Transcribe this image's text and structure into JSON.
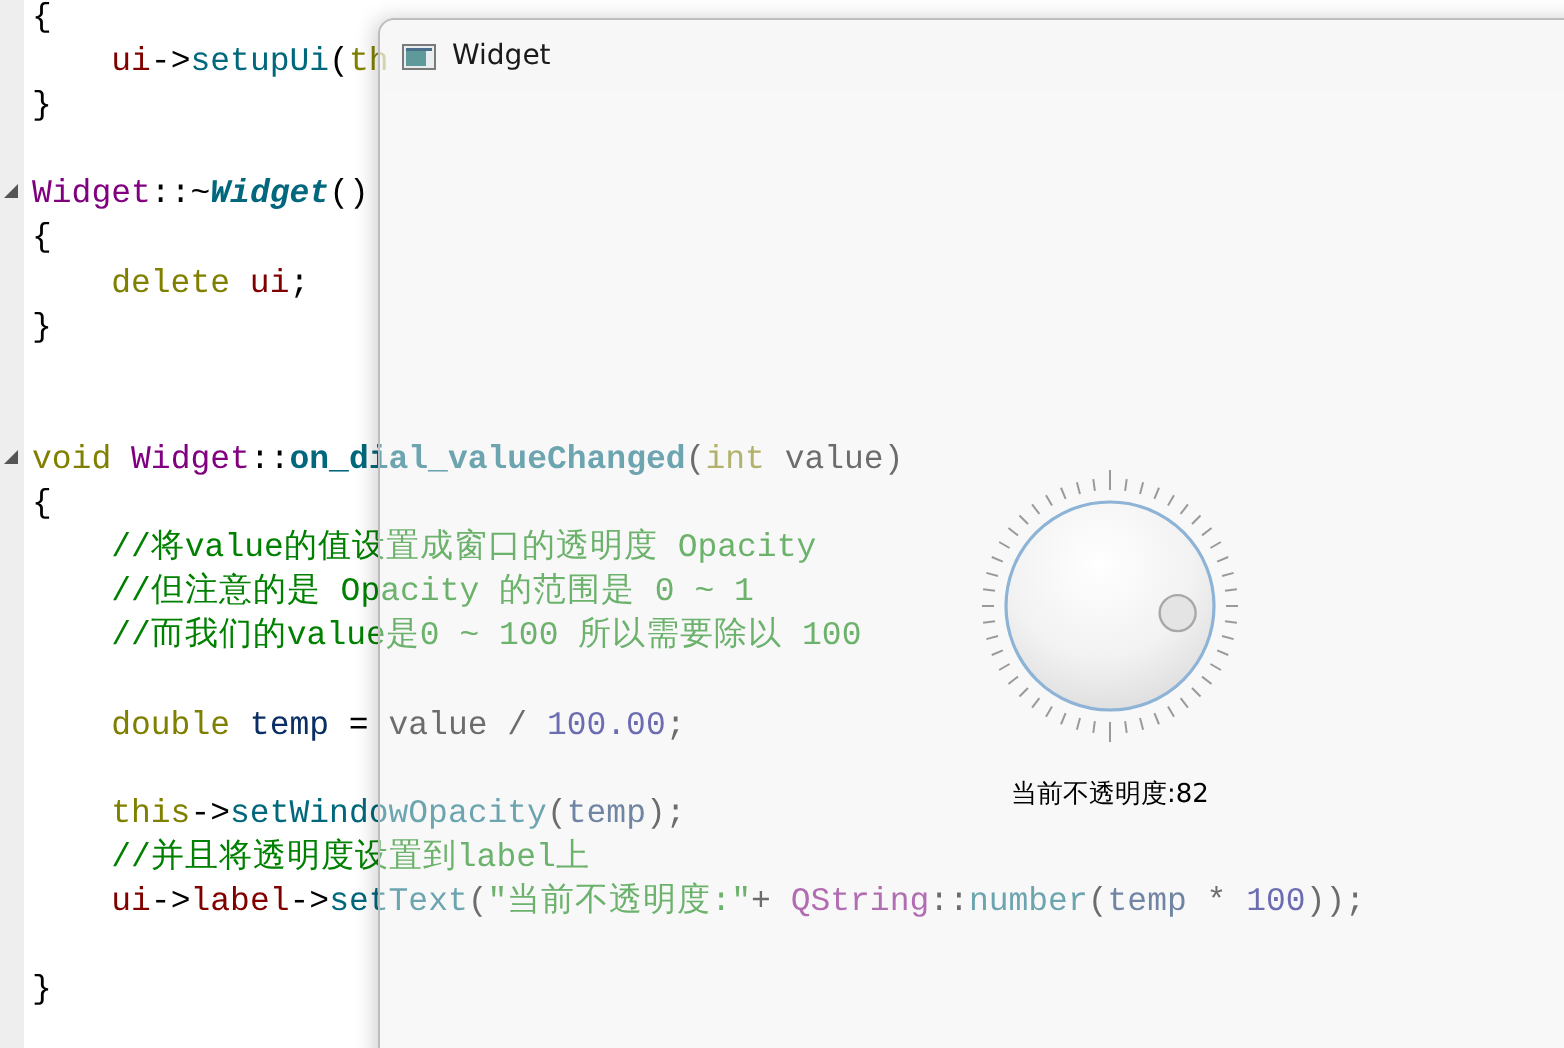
{
  "editor": {
    "lines": [
      {
        "kind": "code",
        "fold": false,
        "tokens": [
          {
            "kind": "plain",
            "text": "{"
          }
        ]
      },
      {
        "kind": "code",
        "fold": false,
        "tokens": [
          {
            "kind": "member",
            "text": "    ui"
          },
          {
            "kind": "plain",
            "text": "->"
          },
          {
            "kind": "func",
            "text": "setupUi"
          },
          {
            "kind": "plain",
            "text": "("
          },
          {
            "kind": "keyword",
            "text": "th"
          }
        ]
      },
      {
        "kind": "code",
        "fold": false,
        "tokens": [
          {
            "kind": "plain",
            "text": "}"
          }
        ]
      },
      {
        "kind": "blank"
      },
      {
        "kind": "code",
        "fold": true,
        "tokens": [
          {
            "kind": "type",
            "text": "Widget"
          },
          {
            "kind": "plain",
            "text": "::~"
          },
          {
            "kind": "func-italic",
            "text": "Widget"
          },
          {
            "kind": "plain",
            "text": "()"
          }
        ]
      },
      {
        "kind": "code",
        "fold": false,
        "tokens": [
          {
            "kind": "plain",
            "text": "{"
          }
        ]
      },
      {
        "kind": "code",
        "fold": false,
        "tokens": [
          {
            "kind": "keyword",
            "text": "    delete "
          },
          {
            "kind": "member",
            "text": "ui"
          },
          {
            "kind": "plain",
            "text": ";"
          }
        ]
      },
      {
        "kind": "code",
        "fold": false,
        "tokens": [
          {
            "kind": "plain",
            "text": "}"
          }
        ]
      },
      {
        "kind": "blank"
      },
      {
        "kind": "blank"
      },
      {
        "kind": "code",
        "fold": true,
        "tokens": [
          {
            "kind": "keyword",
            "text": "void "
          },
          {
            "kind": "type",
            "text": "Widget"
          },
          {
            "kind": "plain",
            "text": "::"
          },
          {
            "kind": "func-bold",
            "text": "on_dial_valueChanged"
          },
          {
            "kind": "plain",
            "text": "("
          },
          {
            "kind": "keyword",
            "text": "int"
          },
          {
            "kind": "plain",
            "text": " value)"
          }
        ]
      },
      {
        "kind": "code",
        "fold": false,
        "tokens": [
          {
            "kind": "plain",
            "text": "{"
          }
        ]
      },
      {
        "kind": "code",
        "fold": false,
        "tokens": [
          {
            "kind": "comment",
            "text": "    //将value的值设置成窗口的透明度 Opacity"
          }
        ]
      },
      {
        "kind": "code",
        "fold": false,
        "tokens": [
          {
            "kind": "comment",
            "text": "    //但注意的是 Opacity 的范围是 0 ~ 1"
          }
        ]
      },
      {
        "kind": "code",
        "fold": false,
        "tokens": [
          {
            "kind": "comment",
            "text": "    //而我们的value是0 ~ 100 所以需要除以 100"
          }
        ]
      },
      {
        "kind": "blank"
      },
      {
        "kind": "code",
        "fold": false,
        "tokens": [
          {
            "kind": "keyword",
            "text": "    double "
          },
          {
            "kind": "local",
            "text": "temp"
          },
          {
            "kind": "plain",
            "text": " = value / "
          },
          {
            "kind": "number",
            "text": "100.00"
          },
          {
            "kind": "plain",
            "text": ";"
          }
        ]
      },
      {
        "kind": "blank"
      },
      {
        "kind": "code",
        "fold": false,
        "tokens": [
          {
            "kind": "keyword",
            "text": "    this"
          },
          {
            "kind": "plain",
            "text": "->"
          },
          {
            "kind": "func",
            "text": "setWindowOpacity"
          },
          {
            "kind": "plain",
            "text": "("
          },
          {
            "kind": "local",
            "text": "temp"
          },
          {
            "kind": "plain",
            "text": ");"
          }
        ]
      },
      {
        "kind": "code",
        "fold": false,
        "tokens": [
          {
            "kind": "comment",
            "text": "    //并且将透明度设置到label上"
          }
        ]
      },
      {
        "kind": "code",
        "fold": false,
        "tokens": [
          {
            "kind": "member",
            "text": "    ui"
          },
          {
            "kind": "plain",
            "text": "->"
          },
          {
            "kind": "member",
            "text": "label"
          },
          {
            "kind": "plain",
            "text": "->"
          },
          {
            "kind": "func",
            "text": "setText"
          },
          {
            "kind": "plain",
            "text": "("
          },
          {
            "kind": "string",
            "text": "\"当前不透明度:\""
          },
          {
            "kind": "plain",
            "text": "+ "
          },
          {
            "kind": "type",
            "text": "QString"
          },
          {
            "kind": "plain",
            "text": "::"
          },
          {
            "kind": "func",
            "text": "number"
          },
          {
            "kind": "plain",
            "text": "("
          },
          {
            "kind": "local",
            "text": "temp"
          },
          {
            "kind": "plain",
            "text": " * "
          },
          {
            "kind": "number",
            "text": "100"
          },
          {
            "kind": "plain",
            "text": "));"
          }
        ]
      },
      {
        "kind": "blank"
      },
      {
        "kind": "code",
        "fold": false,
        "tokens": [
          {
            "kind": "plain",
            "text": "}"
          }
        ]
      }
    ]
  },
  "window": {
    "title": "Widget",
    "dial": {
      "level": 0.82
    },
    "label": "当前不透明度:82"
  }
}
